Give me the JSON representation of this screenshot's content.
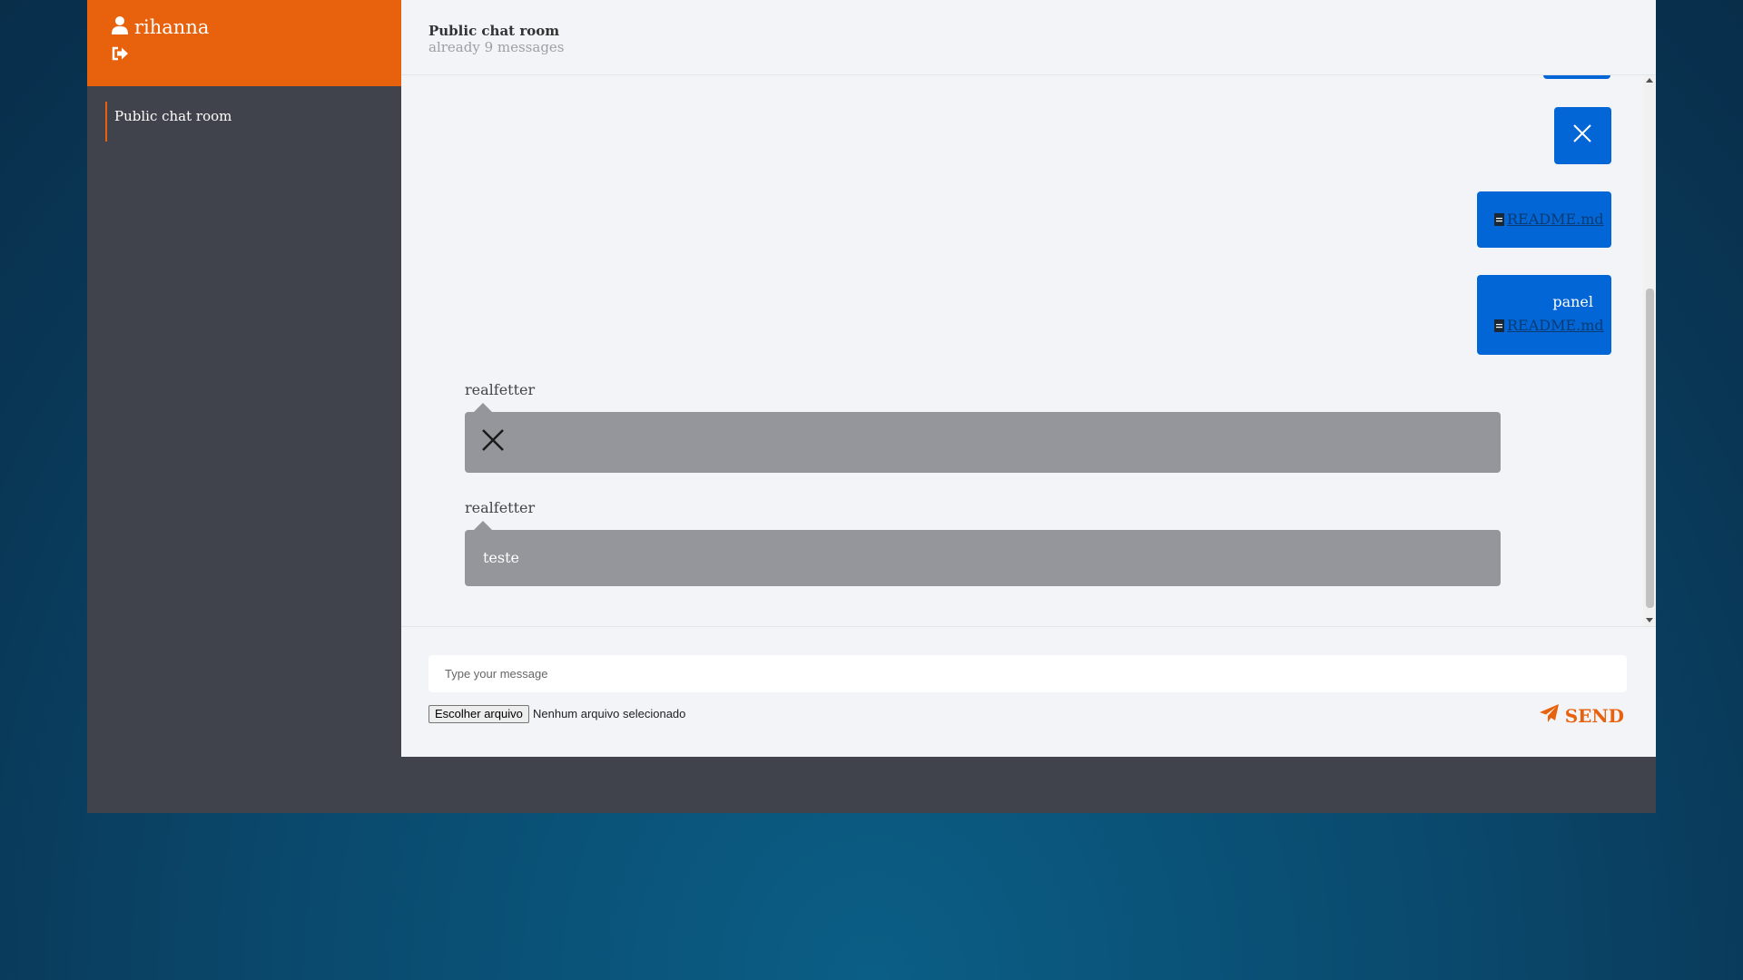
{
  "user": {
    "name": "rihanna",
    "avatar_icon": "user-icon",
    "logout_icon": "sign-out-icon"
  },
  "sidebar": {
    "rooms": [
      {
        "label": "Public chat room",
        "active": true
      }
    ]
  },
  "chat": {
    "title": "Public chat room",
    "subtitle": "already 9 messages"
  },
  "messages": {
    "own": [
      {
        "type": "image-placeholder",
        "icon": "close-icon"
      },
      {
        "type": "file",
        "file_icon": "file-icon",
        "filename": "README.md"
      },
      {
        "type": "text-file",
        "text": "panel",
        "file_icon": "file-icon",
        "filename": "README.md"
      }
    ],
    "others": [
      {
        "sender": "realfetter",
        "type": "image-placeholder",
        "icon": "close-icon"
      },
      {
        "sender": "realfetter",
        "type": "text",
        "text": "teste"
      }
    ]
  },
  "composer": {
    "placeholder": "Type your message",
    "file_button": "Escolher arquivo",
    "file_status": "Nenhum arquivo selecionado",
    "send_label": "SEND",
    "send_icon": "paper-plane-icon"
  },
  "colors": {
    "accent": "#e8610c",
    "own_bubble": "#0366d6",
    "other_bubble": "#94969c",
    "sidebar": "#41434c",
    "main_bg": "#f2f4f7"
  }
}
